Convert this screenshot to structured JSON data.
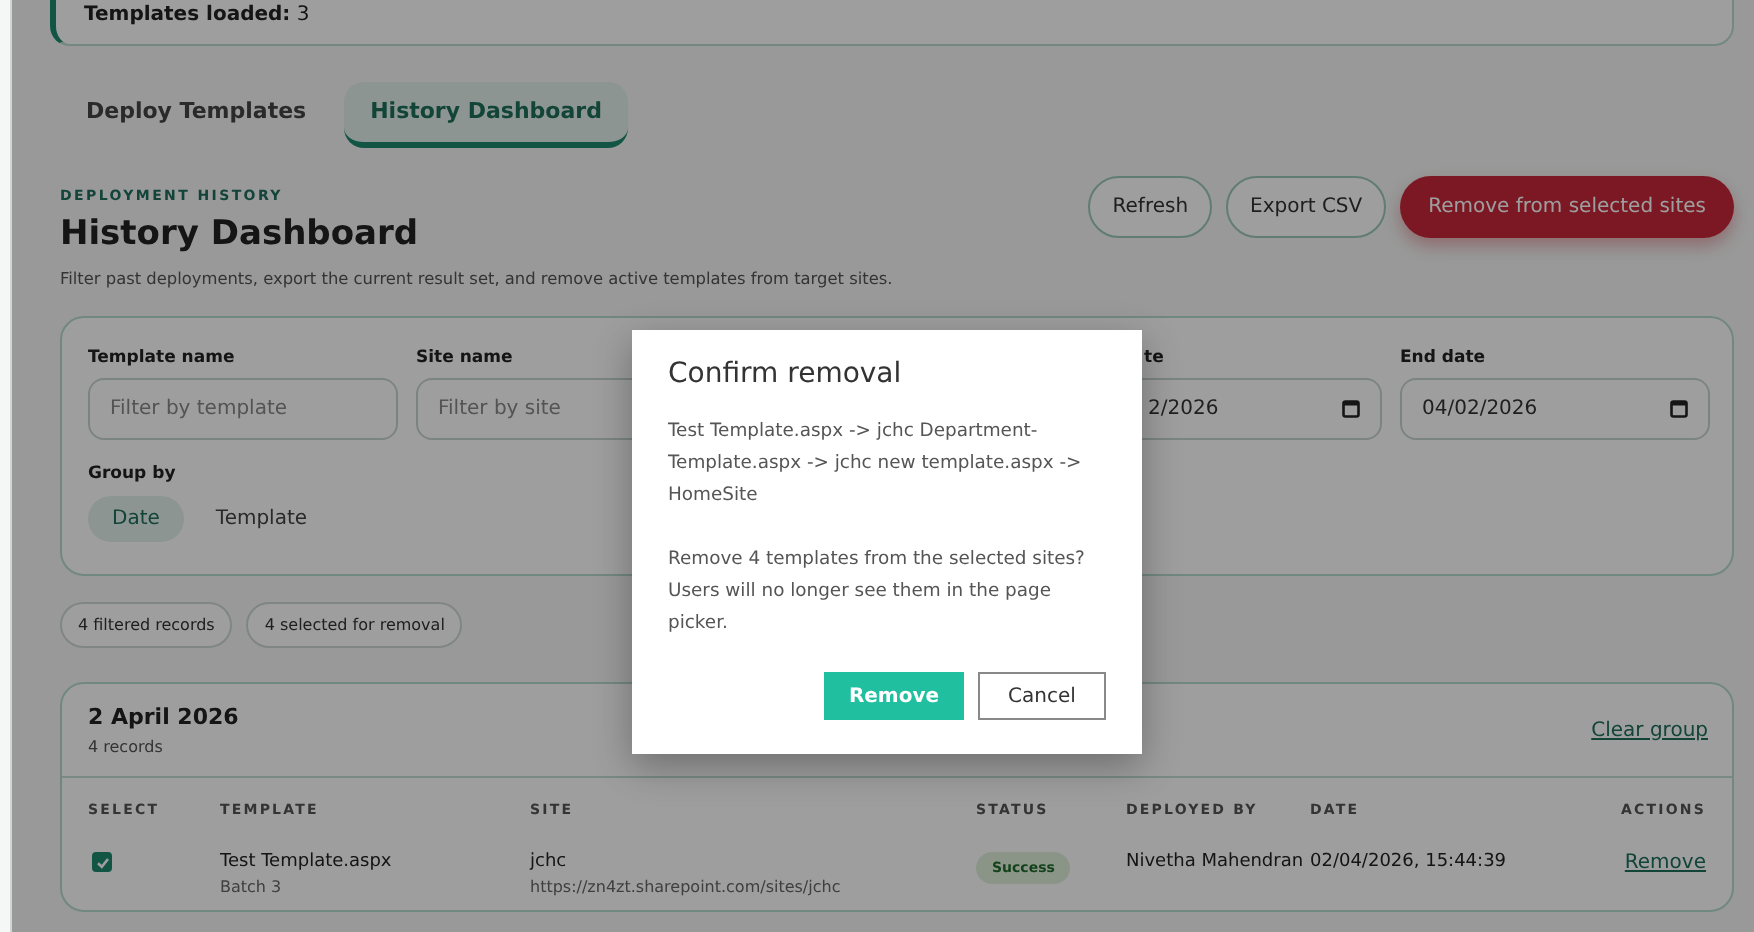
{
  "banner": {
    "label": "Templates loaded:",
    "value": "3"
  },
  "tabs": [
    {
      "label": "Deploy Templates",
      "selected": false
    },
    {
      "label": "History Dashboard",
      "selected": true
    }
  ],
  "header": {
    "eyebrow": "DEPLOYMENT HISTORY",
    "title": "History Dashboard",
    "description": "Filter past deployments, export the current result set, and remove active templates from target sites."
  },
  "actions": [
    {
      "label": "Refresh",
      "kind": "outline"
    },
    {
      "label": "Export CSV",
      "kind": "outline"
    },
    {
      "label": "Remove from selected sites",
      "kind": "danger"
    }
  ],
  "filters": [
    {
      "label": "Template name",
      "placeholder": "Filter by template",
      "kind": "text"
    },
    {
      "label": "Site name",
      "placeholder": "Filter by site",
      "kind": "text"
    },
    {
      "label": "te",
      "value": "2/2026",
      "kind": "date"
    },
    {
      "label": "End date",
      "value": "04/02/2026",
      "kind": "date"
    }
  ],
  "group_by": {
    "label": "Group by",
    "options": [
      {
        "label": "Date",
        "selected": true
      },
      {
        "label": "Template",
        "selected": false
      }
    ]
  },
  "chips": [
    "4 filtered records",
    "4 selected for removal"
  ],
  "group": {
    "title": "2 April 2026",
    "count": "4 records",
    "clear": "Clear group",
    "columns": [
      "SELECT",
      "TEMPLATE",
      "SITE",
      "STATUS",
      "DEPLOYED BY",
      "DATE",
      "ACTIONS"
    ],
    "rows": [
      {
        "checked": true,
        "template": "Test Template.aspx",
        "batch": "Batch 3",
        "site": "jchc",
        "url": "https://zn4zt.sharepoint.com/sites/jchc",
        "status": "Success",
        "deployed_by": "Nivetha Mahendran",
        "date": "02/04/2026, 15:44:39",
        "action": "Remove"
      }
    ]
  },
  "dialog": {
    "title": "Confirm removal",
    "paths": "Test Template.aspx -> jchc Department-Template.aspx -> jchc new template.aspx -> HomeSite",
    "message": "Remove 4 templates from the selected sites? Users will no longer see them in the page picker.",
    "confirm": "Remove",
    "cancel": "Cancel"
  }
}
